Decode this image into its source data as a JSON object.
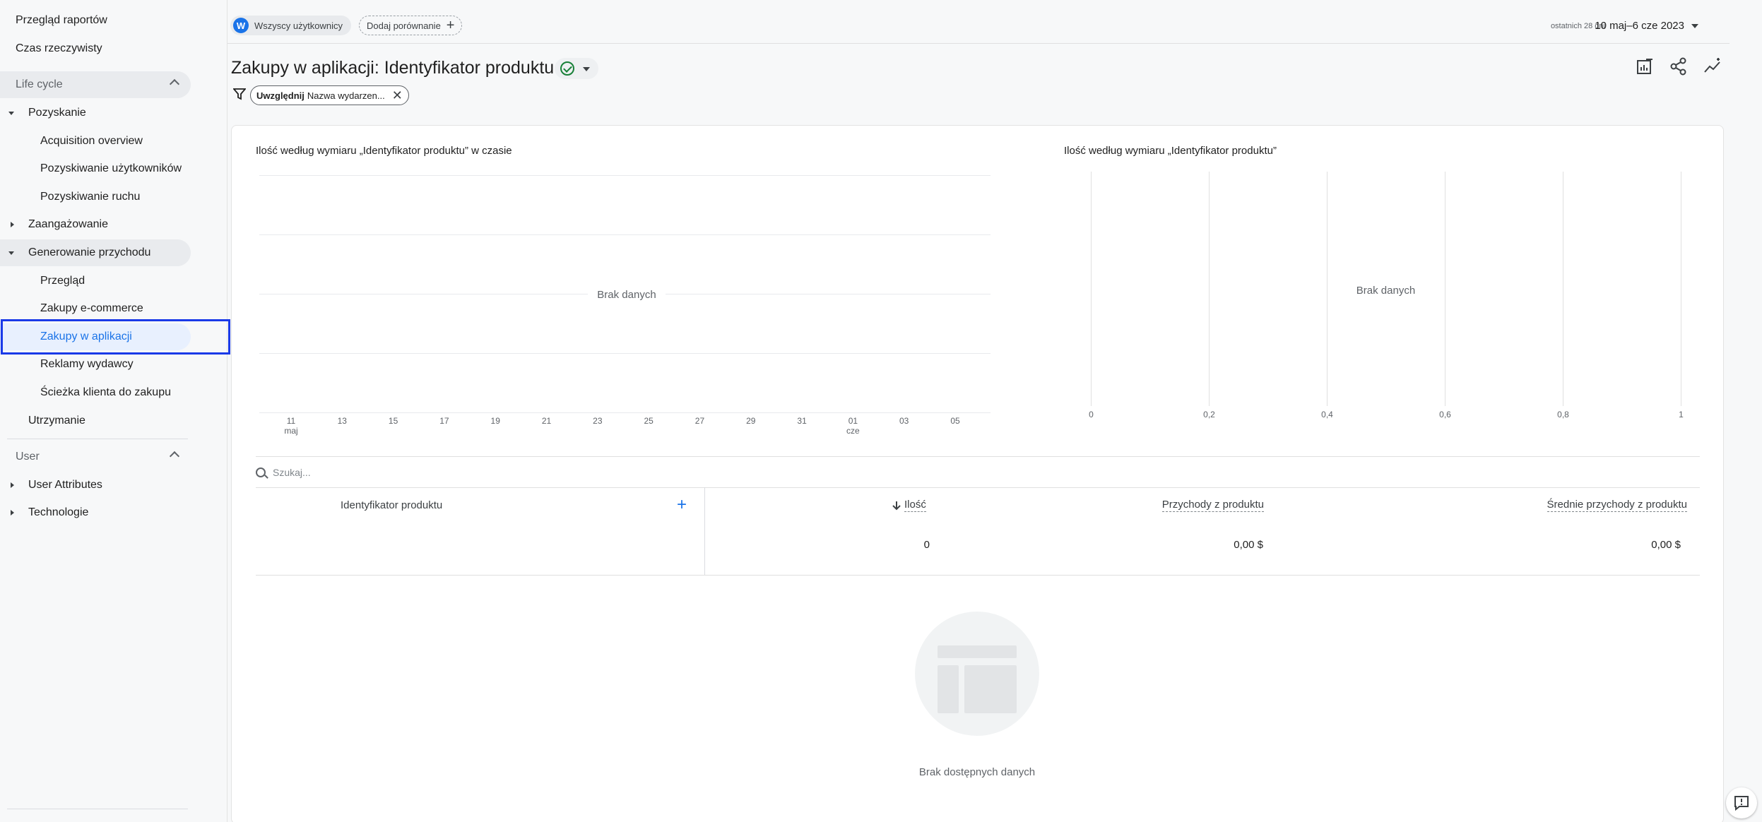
{
  "sidebar": {
    "items": [
      {
        "label": "Przegląd raportów"
      },
      {
        "label": "Czas rzeczywisty"
      },
      {
        "label": "Life cycle"
      },
      {
        "label": "Pozyskanie"
      },
      {
        "label": "Acquisition overview"
      },
      {
        "label": "Pozyskiwanie użytkowników"
      },
      {
        "label": "Pozyskiwanie ruchu"
      },
      {
        "label": "Zaangażowanie"
      },
      {
        "label": "Generowanie przychodu"
      },
      {
        "label": "Przegląd"
      },
      {
        "label": "Zakupy e-commerce"
      },
      {
        "label": "Zakupy w aplikacji"
      },
      {
        "label": "Reklamy wydawcy"
      },
      {
        "label": "Ścieżka klienta do zakupu"
      },
      {
        "label": "Utrzymanie"
      },
      {
        "label": "User"
      },
      {
        "label": "User Attributes"
      },
      {
        "label": "Technologie"
      }
    ]
  },
  "topbar": {
    "avatar_letter": "W",
    "segment_label": "Wszyscy użytkownicy",
    "compare_label": "Dodaj porównanie",
    "date_period": "ostatnich 28 dni",
    "date_range": "10 maj–6 cze 2023"
  },
  "page": {
    "title": "Zakupy w aplikacji: Identyfikator produktu"
  },
  "filter": {
    "bold": "Uwzględnij",
    "text": "Nazwa wydarzen..."
  },
  "line_chart": {
    "title": "Ilość według wymiaru „Identyfikator produktu” w czasie",
    "no_data": "Brak danych",
    "x_ticks": [
      "11",
      "13",
      "15",
      "17",
      "19",
      "21",
      "23",
      "25",
      "27",
      "29",
      "31",
      "01",
      "03",
      "05"
    ],
    "sub_label_maj": "maj",
    "sub_label_cze": "cze"
  },
  "bar_chart": {
    "title": "Ilość według wymiaru „Identyfikator produktu”",
    "no_data": "Brak danych",
    "x_ticks": [
      "0",
      "0,2",
      "0,4",
      "0,6",
      "0,8",
      "1"
    ]
  },
  "chart_data": [
    {
      "type": "line",
      "title": "Ilość według wymiaru „Identyfikator produktu” w czasie",
      "x": [
        "11 maj",
        "13",
        "15",
        "17",
        "19",
        "21",
        "23",
        "25",
        "27",
        "29",
        "31",
        "01 cze",
        "03",
        "05"
      ],
      "series": [],
      "annotation": "Brak danych"
    },
    {
      "type": "bar",
      "title": "Ilość według wymiaru „Identyfikator produktu”",
      "categories": [],
      "values": [],
      "xlim": [
        0,
        1
      ],
      "annotation": "Brak danych"
    }
  ],
  "table": {
    "search_placeholder": "Szukaj...",
    "dimension_header": "Identyfikator produktu",
    "metric_headers": [
      "Ilość",
      "Przychody z produktu",
      "Średnie przychody z produktu"
    ],
    "totals": [
      "0",
      "0,00 $",
      "0,00 $"
    ]
  },
  "empty_state": {
    "text": "Brak dostępnych danych"
  },
  "colors": {
    "accent": "#1a73e8",
    "highlight_box": "#1a3ae8",
    "success": "#188038"
  }
}
